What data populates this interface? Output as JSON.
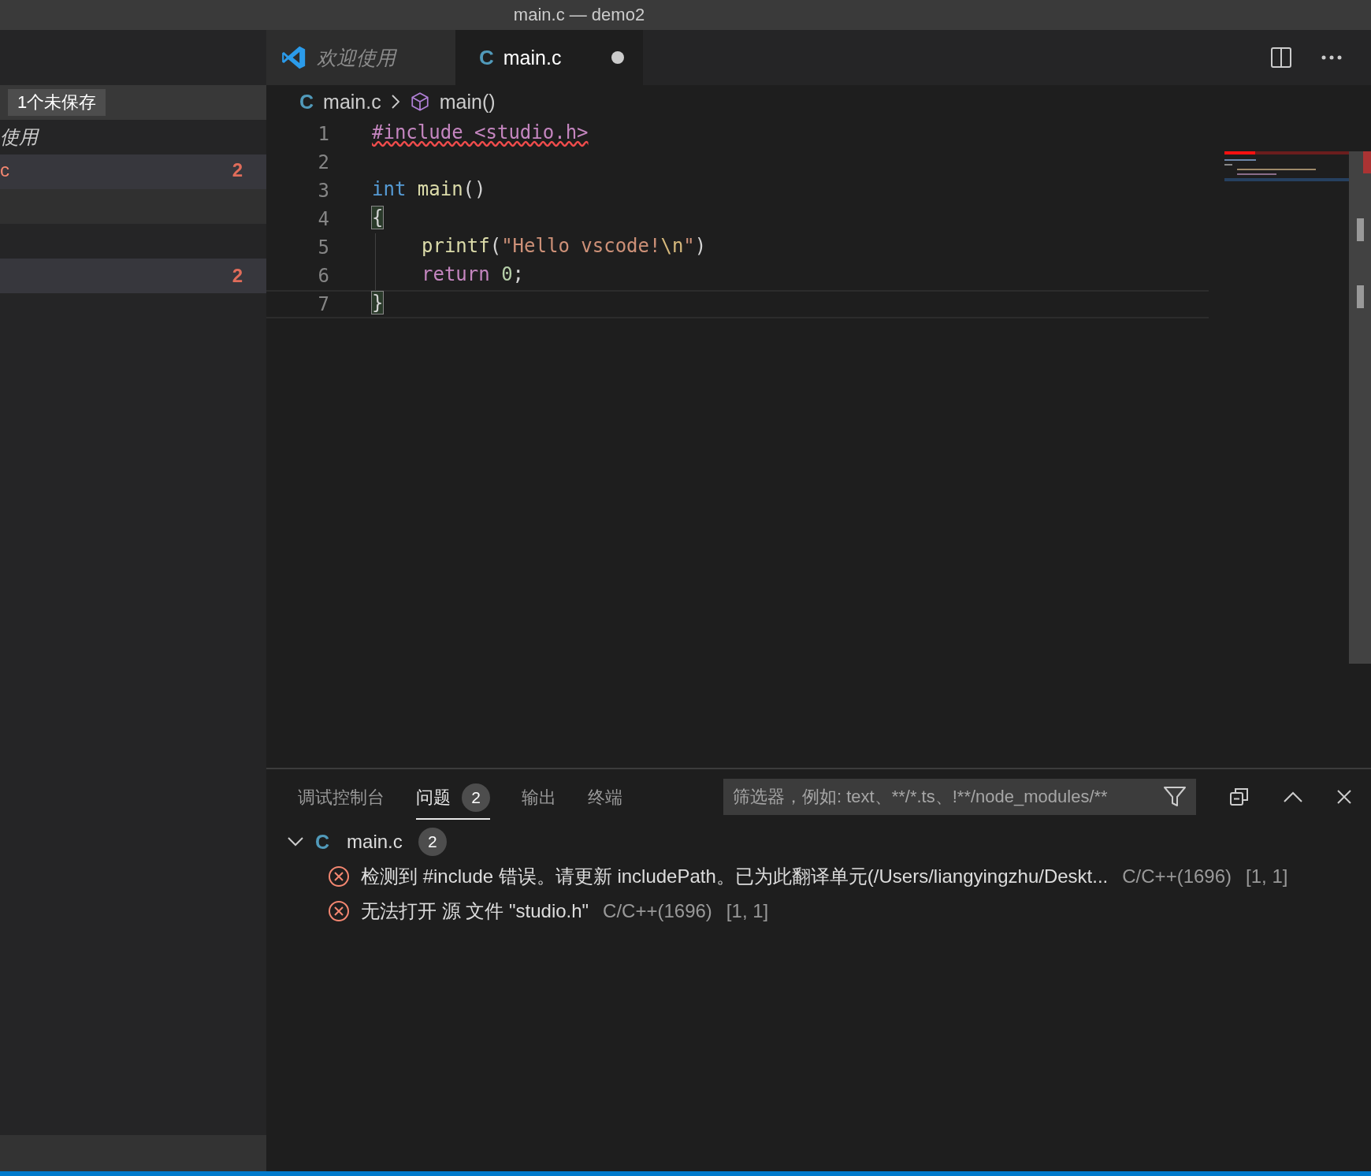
{
  "window": {
    "title": "main.c — demo2"
  },
  "sidebar": {
    "unsaved_badge": "1个未保存",
    "open_editors": [
      {
        "label": "使用",
        "selected": false,
        "error": false
      },
      {
        "label": "c",
        "badge": "2",
        "selected": true,
        "error": true
      }
    ],
    "rows": [
      {
        "badge": "2",
        "selected": true
      }
    ]
  },
  "tabs": [
    {
      "label": "欢迎使用",
      "kind": "welcome",
      "selected": false,
      "dirty": false
    },
    {
      "label": "main.c",
      "kind": "file",
      "icon": "C",
      "selected": true,
      "dirty": true
    }
  ],
  "breadcrumb": [
    {
      "label": "main.c",
      "kind": "file",
      "icon": "C"
    },
    {
      "label": "main()",
      "kind": "function"
    }
  ],
  "code": [
    {
      "number": "1",
      "error": true,
      "tokens": [
        {
          "text": "#include <studio.h>",
          "kind": "preproc"
        }
      ]
    },
    {
      "number": "2"
    },
    {
      "number": "3",
      "tokens": [
        {
          "text": "int ",
          "kind": "keyword"
        },
        {
          "text": "main",
          "kind": "function"
        },
        {
          "text": "()",
          "kind": "plain"
        }
      ]
    },
    {
      "number": "4",
      "tokens": [
        {
          "text": "{",
          "kind": "bracket"
        }
      ]
    },
    {
      "number": "5",
      "indented": true,
      "tokens": [
        {
          "text": "printf",
          "kind": "function"
        },
        {
          "text": "(",
          "kind": "plain"
        },
        {
          "text": "\"Hello vscode!",
          "kind": "string"
        },
        {
          "text": "\\n",
          "kind": "escape"
        },
        {
          "text": "\"",
          "kind": "string"
        },
        {
          "text": ")",
          "kind": "plain"
        }
      ]
    },
    {
      "number": "6",
      "indented": true,
      "tokens": [
        {
          "text": "return ",
          "kind": "control"
        },
        {
          "text": "0",
          "kind": "number"
        },
        {
          "text": ";",
          "kind": "plain"
        }
      ]
    },
    {
      "number": "7",
      "current": true,
      "tokens": [
        {
          "text": "}",
          "kind": "bracket"
        }
      ]
    }
  ],
  "panel": {
    "tabs": [
      {
        "label": "调试控制台",
        "selected": false
      },
      {
        "label": "问题",
        "badge": "2",
        "selected": true
      },
      {
        "label": "输出",
        "selected": false
      },
      {
        "label": "终端",
        "selected": false
      }
    ],
    "filter": {
      "placeholder": "筛选器，例如: text、**/*.ts、!**/node_modules/**"
    },
    "problems": [
      {
        "file": "main.c",
        "icon": "C",
        "count": "2",
        "expanded": true,
        "children": [
          {
            "message": "检测到 #include 错误。请更新 includePath。已为此翻译单元(/Users/liangyingzhu/Deskt...",
            "source": "C/C++(1696)",
            "position": "[1, 1]"
          },
          {
            "message": "无法打开 源 文件 \"studio.h\"",
            "source": "C/C++(1696)",
            "position": "[1, 1]"
          }
        ]
      }
    ]
  }
}
